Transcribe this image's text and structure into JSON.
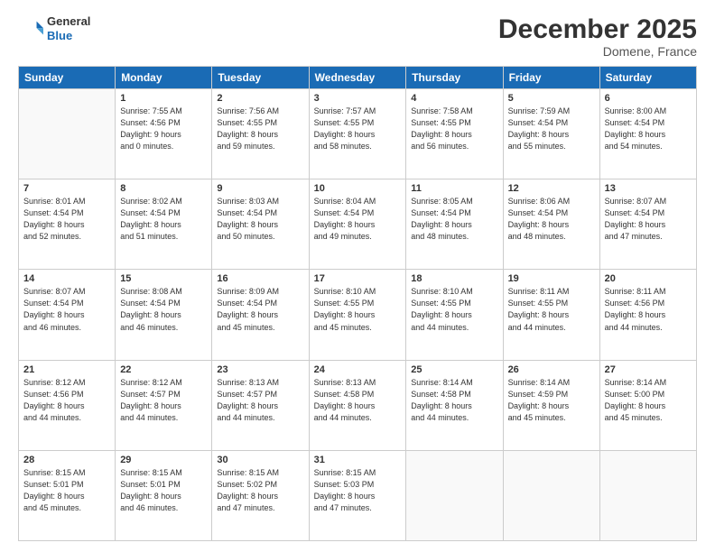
{
  "header": {
    "logo": {
      "general": "General",
      "blue": "Blue"
    },
    "title": "December 2025",
    "location": "Domene, France"
  },
  "days_of_week": [
    "Sunday",
    "Monday",
    "Tuesday",
    "Wednesday",
    "Thursday",
    "Friday",
    "Saturday"
  ],
  "weeks": [
    [
      {
        "day": "",
        "info": ""
      },
      {
        "day": "1",
        "info": "Sunrise: 7:55 AM\nSunset: 4:56 PM\nDaylight: 9 hours\nand 0 minutes."
      },
      {
        "day": "2",
        "info": "Sunrise: 7:56 AM\nSunset: 4:55 PM\nDaylight: 8 hours\nand 59 minutes."
      },
      {
        "day": "3",
        "info": "Sunrise: 7:57 AM\nSunset: 4:55 PM\nDaylight: 8 hours\nand 58 minutes."
      },
      {
        "day": "4",
        "info": "Sunrise: 7:58 AM\nSunset: 4:55 PM\nDaylight: 8 hours\nand 56 minutes."
      },
      {
        "day": "5",
        "info": "Sunrise: 7:59 AM\nSunset: 4:54 PM\nDaylight: 8 hours\nand 55 minutes."
      },
      {
        "day": "6",
        "info": "Sunrise: 8:00 AM\nSunset: 4:54 PM\nDaylight: 8 hours\nand 54 minutes."
      }
    ],
    [
      {
        "day": "7",
        "info": "Sunrise: 8:01 AM\nSunset: 4:54 PM\nDaylight: 8 hours\nand 52 minutes."
      },
      {
        "day": "8",
        "info": "Sunrise: 8:02 AM\nSunset: 4:54 PM\nDaylight: 8 hours\nand 51 minutes."
      },
      {
        "day": "9",
        "info": "Sunrise: 8:03 AM\nSunset: 4:54 PM\nDaylight: 8 hours\nand 50 minutes."
      },
      {
        "day": "10",
        "info": "Sunrise: 8:04 AM\nSunset: 4:54 PM\nDaylight: 8 hours\nand 49 minutes."
      },
      {
        "day": "11",
        "info": "Sunrise: 8:05 AM\nSunset: 4:54 PM\nDaylight: 8 hours\nand 48 minutes."
      },
      {
        "day": "12",
        "info": "Sunrise: 8:06 AM\nSunset: 4:54 PM\nDaylight: 8 hours\nand 48 minutes."
      },
      {
        "day": "13",
        "info": "Sunrise: 8:07 AM\nSunset: 4:54 PM\nDaylight: 8 hours\nand 47 minutes."
      }
    ],
    [
      {
        "day": "14",
        "info": "Sunrise: 8:07 AM\nSunset: 4:54 PM\nDaylight: 8 hours\nand 46 minutes."
      },
      {
        "day": "15",
        "info": "Sunrise: 8:08 AM\nSunset: 4:54 PM\nDaylight: 8 hours\nand 46 minutes."
      },
      {
        "day": "16",
        "info": "Sunrise: 8:09 AM\nSunset: 4:54 PM\nDaylight: 8 hours\nand 45 minutes."
      },
      {
        "day": "17",
        "info": "Sunrise: 8:10 AM\nSunset: 4:55 PM\nDaylight: 8 hours\nand 45 minutes."
      },
      {
        "day": "18",
        "info": "Sunrise: 8:10 AM\nSunset: 4:55 PM\nDaylight: 8 hours\nand 44 minutes."
      },
      {
        "day": "19",
        "info": "Sunrise: 8:11 AM\nSunset: 4:55 PM\nDaylight: 8 hours\nand 44 minutes."
      },
      {
        "day": "20",
        "info": "Sunrise: 8:11 AM\nSunset: 4:56 PM\nDaylight: 8 hours\nand 44 minutes."
      }
    ],
    [
      {
        "day": "21",
        "info": "Sunrise: 8:12 AM\nSunset: 4:56 PM\nDaylight: 8 hours\nand 44 minutes."
      },
      {
        "day": "22",
        "info": "Sunrise: 8:12 AM\nSunset: 4:57 PM\nDaylight: 8 hours\nand 44 minutes."
      },
      {
        "day": "23",
        "info": "Sunrise: 8:13 AM\nSunset: 4:57 PM\nDaylight: 8 hours\nand 44 minutes."
      },
      {
        "day": "24",
        "info": "Sunrise: 8:13 AM\nSunset: 4:58 PM\nDaylight: 8 hours\nand 44 minutes."
      },
      {
        "day": "25",
        "info": "Sunrise: 8:14 AM\nSunset: 4:58 PM\nDaylight: 8 hours\nand 44 minutes."
      },
      {
        "day": "26",
        "info": "Sunrise: 8:14 AM\nSunset: 4:59 PM\nDaylight: 8 hours\nand 45 minutes."
      },
      {
        "day": "27",
        "info": "Sunrise: 8:14 AM\nSunset: 5:00 PM\nDaylight: 8 hours\nand 45 minutes."
      }
    ],
    [
      {
        "day": "28",
        "info": "Sunrise: 8:15 AM\nSunset: 5:01 PM\nDaylight: 8 hours\nand 45 minutes."
      },
      {
        "day": "29",
        "info": "Sunrise: 8:15 AM\nSunset: 5:01 PM\nDaylight: 8 hours\nand 46 minutes."
      },
      {
        "day": "30",
        "info": "Sunrise: 8:15 AM\nSunset: 5:02 PM\nDaylight: 8 hours\nand 47 minutes."
      },
      {
        "day": "31",
        "info": "Sunrise: 8:15 AM\nSunset: 5:03 PM\nDaylight: 8 hours\nand 47 minutes."
      },
      {
        "day": "",
        "info": ""
      },
      {
        "day": "",
        "info": ""
      },
      {
        "day": "",
        "info": ""
      }
    ]
  ]
}
